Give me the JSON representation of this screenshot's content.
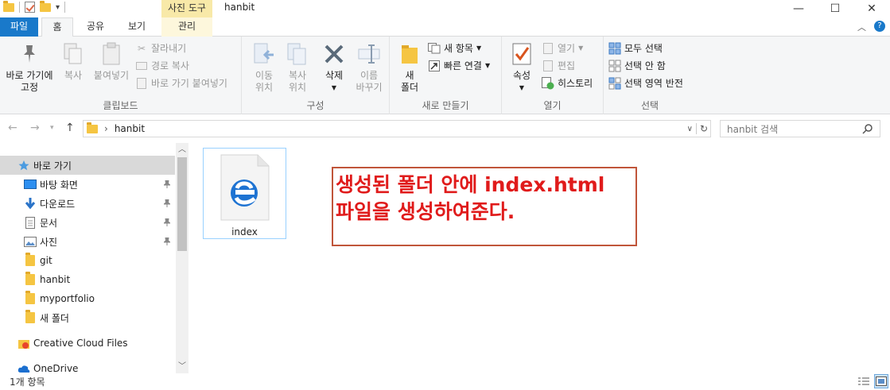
{
  "window": {
    "title": "hanbit",
    "contextual_tab_header": "사진 도구",
    "buttons": {
      "minimize": "—",
      "maximize": "☐",
      "close": "✕"
    }
  },
  "ribbon_tabs": {
    "file": "파일",
    "home": "홈",
    "share": "공유",
    "view": "보기",
    "manage": "관리"
  },
  "ribbon": {
    "clipboard": {
      "label": "클립보드",
      "pin_quick": "바로 가기에\n고정",
      "copy": "복사",
      "paste": "붙여넣기",
      "cut": "잘라내기",
      "copy_path": "경로 복사",
      "paste_shortcut": "바로 가기 붙여넣기"
    },
    "organize": {
      "label": "구성",
      "move_to": "이동\n위치",
      "copy_to": "복사\n위치",
      "delete": "삭제",
      "rename": "이름\n바꾸기"
    },
    "new": {
      "label": "새로 만들기",
      "new_folder": "새\n폴더",
      "new_item": "새 항목",
      "easy_access": "빠른 연결"
    },
    "open": {
      "label": "열기",
      "properties": "속성",
      "open": "열기",
      "edit": "편집",
      "history": "히스토리"
    },
    "select": {
      "label": "선택",
      "select_all": "모두 선택",
      "select_none": "선택 안 함",
      "invert": "선택 영역 반전"
    }
  },
  "address": {
    "path": "hanbit",
    "search_placeholder": "hanbit 검색"
  },
  "nav_pane": {
    "quick_access": "바로 가기",
    "items": [
      {
        "label": "바탕 화면",
        "pinned": true
      },
      {
        "label": "다운로드",
        "pinned": true
      },
      {
        "label": "문서",
        "pinned": true
      },
      {
        "label": "사진",
        "pinned": true
      },
      {
        "label": "git"
      },
      {
        "label": "hanbit"
      },
      {
        "label": "myportfolio"
      },
      {
        "label": "새 폴더"
      }
    ],
    "creative_cloud": "Creative Cloud Files",
    "onedrive": "OneDrive"
  },
  "content": {
    "files": [
      {
        "name": "index",
        "icon": "edge-html-icon"
      }
    ],
    "annotation": {
      "line1": "생성된 폴더 안에 index.html",
      "line2": "파일을 생성하여준다."
    }
  },
  "status": {
    "item_count": "1개 항목"
  },
  "colors": {
    "accent_blue": "#1979ca",
    "annotation_red": "#e01b1b",
    "annotation_border": "#c0553a",
    "tools_tab": "#f8e9a8"
  }
}
